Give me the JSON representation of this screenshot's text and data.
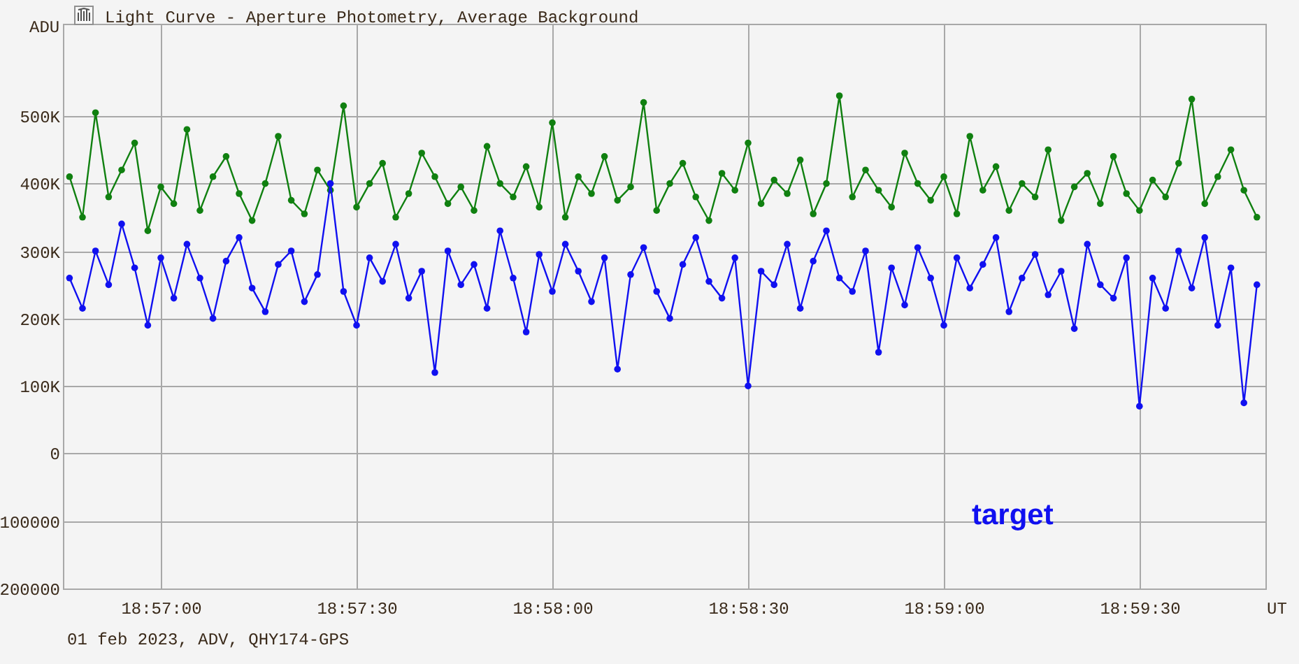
{
  "window": {
    "title": "Light Curve - Aperture Photometry, Average Background"
  },
  "chart": {
    "chart_data": {
      "type": "line",
      "ylabel": "ADU",
      "xlabel": "UT",
      "grid": true,
      "xlim": [
        68205,
        68389.3
      ],
      "ylim": [
        -200000,
        636600
      ],
      "yticks": [
        {
          "value": 500000,
          "label": "500K"
        },
        {
          "value": 400000,
          "label": "400K"
        },
        {
          "value": 300000,
          "label": "300K"
        },
        {
          "value": 200000,
          "label": "200K"
        },
        {
          "value": 100000,
          "label": "100K"
        },
        {
          "value": 0,
          "label": "0"
        },
        {
          "value": -100000,
          "label": "100000"
        },
        {
          "value": -200000,
          "label": "200000"
        }
      ],
      "xticks": [
        {
          "value": 68220,
          "label": "18:57:00"
        },
        {
          "value": 68250,
          "label": "18:57:30"
        },
        {
          "value": 68280,
          "label": "18:58:00"
        },
        {
          "value": 68310,
          "label": "18:58:30"
        },
        {
          "value": 68340,
          "label": "18:59:00"
        },
        {
          "value": 68370,
          "label": "18:59:30"
        }
      ],
      "x": [
        68206,
        68208,
        68210,
        68212,
        68214,
        68216,
        68218,
        68220,
        68222,
        68224,
        68226,
        68228,
        68230,
        68232,
        68234,
        68236,
        68238,
        68240,
        68242,
        68244,
        68246,
        68248,
        68250,
        68252,
        68254,
        68256,
        68258,
        68260,
        68262,
        68264,
        68266,
        68268,
        68270,
        68272,
        68274,
        68276,
        68278,
        68280,
        68282,
        68284,
        68286,
        68288,
        68290,
        68292,
        68294,
        68296,
        68298,
        68300,
        68302,
        68304,
        68306,
        68308,
        68310,
        68312,
        68314,
        68316,
        68318,
        68320,
        68322,
        68324,
        68326,
        68328,
        68330,
        68332,
        68334,
        68336,
        68338,
        68340,
        68342,
        68344,
        68346,
        68348,
        68350,
        68352,
        68354,
        68356,
        68358,
        68360,
        68362,
        68364,
        68366,
        68368,
        68370,
        68372,
        68374,
        68376,
        68378,
        68380,
        68382,
        68384,
        68386,
        68388
      ],
      "series": [
        {
          "color": "#108010",
          "marker": "circle",
          "values": [
            410000,
            350000,
            505000,
            380000,
            420000,
            460000,
            330000,
            395000,
            370000,
            480000,
            360000,
            410000,
            440000,
            385000,
            345000,
            400000,
            470000,
            375000,
            355000,
            420000,
            390000,
            515000,
            365000,
            400000,
            430000,
            350000,
            385000,
            445000,
            410000,
            370000,
            395000,
            360000,
            455000,
            400000,
            380000,
            425000,
            365000,
            490000,
            350000,
            410000,
            385000,
            440000,
            375000,
            395000,
            520000,
            360000,
            400000,
            430000,
            380000,
            345000,
            415000,
            390000,
            460000,
            370000,
            405000,
            385000,
            435000,
            355000,
            400000,
            530000,
            380000,
            420000,
            390000,
            365000,
            445000,
            400000,
            375000,
            410000,
            355000,
            470000,
            390000,
            425000,
            360000,
            400000,
            380000,
            450000,
            345000,
            395000,
            415000,
            370000,
            440000,
            385000,
            360000,
            405000,
            380000,
            430000,
            525000,
            370000,
            410000,
            450000,
            390000,
            350000
          ]
        },
        {
          "name": "target",
          "color": "#1010f0",
          "marker": "circle",
          "values": [
            260000,
            215000,
            300000,
            250000,
            340000,
            275000,
            190000,
            290000,
            230000,
            310000,
            260000,
            200000,
            285000,
            320000,
            245000,
            210000,
            280000,
            300000,
            225000,
            265000,
            400000,
            240000,
            190000,
            290000,
            255000,
            310000,
            230000,
            270000,
            120000,
            300000,
            250000,
            280000,
            215000,
            330000,
            260000,
            180000,
            295000,
            240000,
            310000,
            270000,
            225000,
            290000,
            125000,
            265000,
            305000,
            240000,
            200000,
            280000,
            320000,
            255000,
            230000,
            290000,
            100000,
            270000,
            250000,
            310000,
            215000,
            285000,
            330000,
            260000,
            240000,
            300000,
            150000,
            275000,
            220000,
            305000,
            260000,
            190000,
            290000,
            245000,
            280000,
            320000,
            210000,
            260000,
            295000,
            235000,
            270000,
            185000,
            310000,
            250000,
            230000,
            290000,
            70000,
            260000,
            215000,
            300000,
            245000,
            320000,
            190000,
            275000,
            75000,
            250000
          ]
        }
      ]
    }
  },
  "footer": "01 feb 2023, ADV, QHY174-GPS"
}
